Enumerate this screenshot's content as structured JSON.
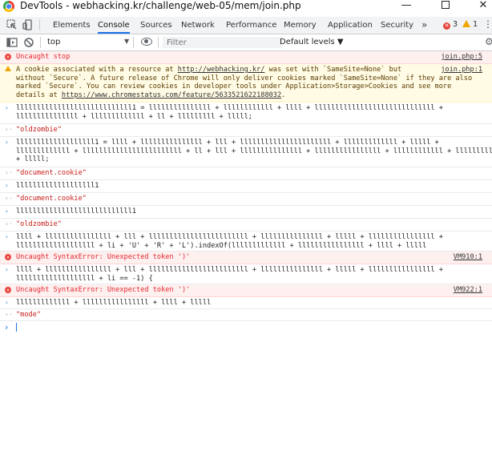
{
  "window": {
    "title": "DevTools - webhacking.kr/challenge/web-05/mem/join.php",
    "minimize": "—",
    "close": "✕"
  },
  "tabs": [
    {
      "label": "Elements"
    },
    {
      "label": "Console",
      "active": true
    },
    {
      "label": "Sources"
    },
    {
      "label": "Network"
    },
    {
      "label": "Performance"
    },
    {
      "label": "Memory"
    },
    {
      "label": "Application"
    },
    {
      "label": "Security"
    }
  ],
  "tabs_overflow": "»",
  "counters": {
    "errors": "3",
    "warnings": "1"
  },
  "toolbar": {
    "context": "top",
    "filter_placeholder": "Filter",
    "levels": "Default levels ▼"
  },
  "colors": {
    "accent": "#1a73e8",
    "error": "#e8443a",
    "warning": "#f0a500",
    "string": "#c41a16"
  },
  "console": {
    "messages": [
      {
        "kind": "error",
        "icon": "error-icon",
        "text": "Uncaught stop",
        "source": "join.php:5"
      },
      {
        "kind": "warning",
        "icon": "warning-icon",
        "line1": "A cookie associated with a resource at ",
        "link1": "http://webhacking.kr/",
        "line1b": " was set with `SameSite=None` but",
        "line2": "without `Secure`. A future release of Chrome will only deliver cookies marked `SameSite=None` if they are also",
        "line3": "marked `Secure`. You can review cookies in developer tools under Application>Storage>Cookies and see more",
        "line4a": "details at ",
        "link2": "https://www.chromestatus.com/feature/5633521622188032",
        "line4b": ".",
        "source": "join.php:1"
      },
      {
        "kind": "input",
        "text": "llllllllllllllllllllllllllll1 = lllllllllllllll + llllllllllll + llll + lllllllllllllllllllllllllllll +\nlllllllllllllll + lllllllllllll + ll + lllllllll + lllll;"
      },
      {
        "kind": "output",
        "text": "\"oldzombie\""
      },
      {
        "kind": "input",
        "text": "lllllllllllllllllll1 = llll + lllllllllllllll + lll + llllllllllllllllllllll + lllllllllllll + lllll +\nlllllllllllll + llllllllllllllllllllllll + ll + lll + lllllllllllllll + llllllllllllllll + llllllllllll + lllllllll\n+ lllll;"
      },
      {
        "kind": "output",
        "text": "\"document.cookie\""
      },
      {
        "kind": "input",
        "text": "lllllllllllllllllll1"
      },
      {
        "kind": "output",
        "text": "\"document.cookie\""
      },
      {
        "kind": "input",
        "text": "llllllllllllllllllllllllllll1"
      },
      {
        "kind": "output",
        "text": "\"oldzombie\""
      },
      {
        "kind": "input",
        "text": "llll + llllllllllllllll + lll + llllllllllllllllllllllll + lllllllllllllll + lllll + llllllllllllllll +\nlllllllllllllllllll + li + 'U' + 'R' + 'L').indexOf(lllllllllllll + llllllllllllllll + llll + lllll"
      },
      {
        "kind": "error",
        "icon": "error-icon",
        "text": "Uncaught SyntaxError: Unexpected token ')'",
        "source": "VM910:1"
      },
      {
        "kind": "input",
        "text": "llll + llllllllllllllll + lll + llllllllllllllllllllllll + lllllllllllllll + lllll + llllllllllllllll +\nlllllllllllllllllll + li == -1) {"
      },
      {
        "kind": "error",
        "icon": "error-icon",
        "text": "Uncaught SyntaxError: Unexpected token ')'",
        "source": "VM922:1"
      },
      {
        "kind": "input",
        "text": "lllllllllllll + llllllllllllllll + llll + lllll"
      },
      {
        "kind": "output",
        "text": "\"mode\""
      }
    ]
  }
}
